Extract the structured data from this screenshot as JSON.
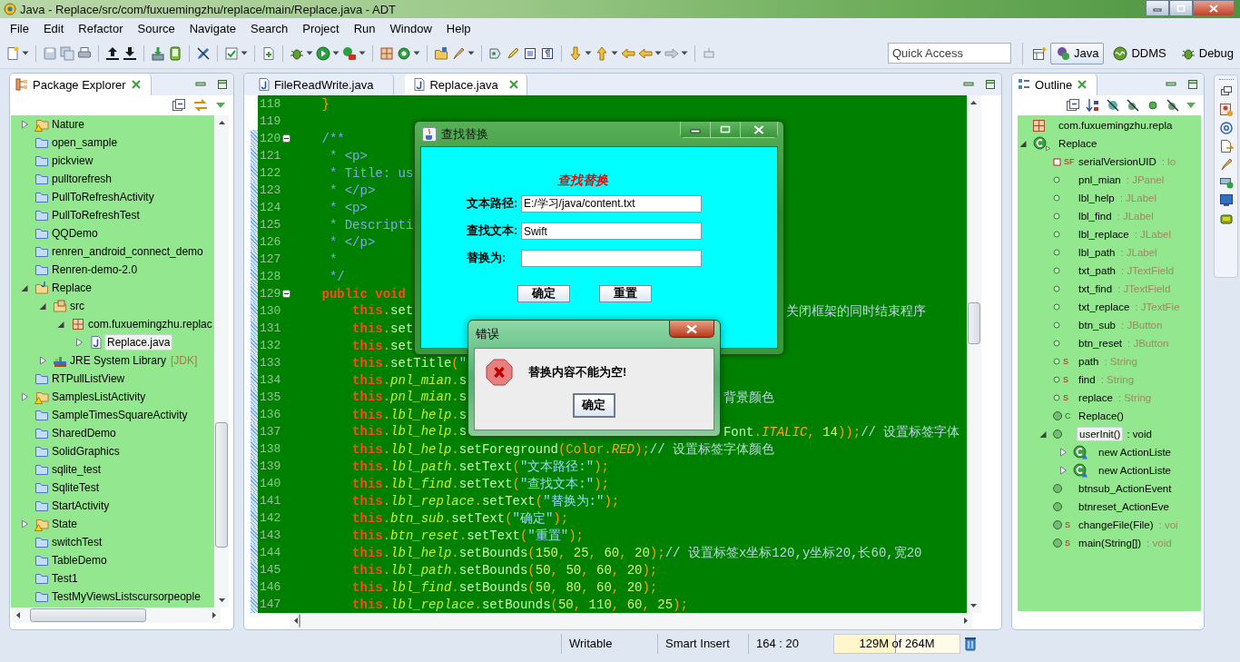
{
  "window": {
    "title": "Java - Replace/src/com/fuxuemingzhu/replace/main/Replace.java - ADT"
  },
  "menu": [
    "File",
    "Edit",
    "Refactor",
    "Source",
    "Navigate",
    "Search",
    "Project",
    "Run",
    "Window",
    "Help"
  ],
  "quick_access": {
    "placeholder": "Quick Access"
  },
  "perspectives": [
    {
      "label": "Java",
      "selected": true
    },
    {
      "label": "DDMS",
      "selected": false
    },
    {
      "label": "Debug",
      "selected": false
    }
  ],
  "package_explorer": {
    "title": "Package Explorer",
    "items": [
      {
        "name": "Nature",
        "kind": "project_warning",
        "expanded": false,
        "selected": false
      },
      {
        "name": "open_sample",
        "kind": "closed",
        "selected": false
      },
      {
        "name": "pickview",
        "kind": "closed",
        "selected": false
      },
      {
        "name": "pulltorefresh",
        "kind": "closed",
        "selected": false
      },
      {
        "name": "PullToRefreshActivity",
        "kind": "closed",
        "selected": false
      },
      {
        "name": "PullToRefreshTest",
        "kind": "closed",
        "selected": false
      },
      {
        "name": "QQDemo",
        "kind": "closed",
        "selected": false
      },
      {
        "name": "renren_android_connect_demo",
        "kind": "closed",
        "selected": false
      },
      {
        "name": "Renren-demo-2.0",
        "kind": "closed",
        "selected": false
      },
      {
        "name": "Replace",
        "kind": "java_project",
        "expanded": true,
        "selected": false,
        "children": [
          {
            "name": "src",
            "kind": "src",
            "expanded": true,
            "selected": false,
            "children": [
              {
                "name": "com.fuxuemingzhu.replac",
                "kind": "package",
                "expanded": true,
                "selected": false,
                "children": [
                  {
                    "name": "Replace.java",
                    "kind": "java",
                    "expanded": false,
                    "selected": true
                  }
                ]
              }
            ]
          },
          {
            "name": "JRE System Library",
            "decoration": "[JDK]",
            "kind": "library",
            "expanded": false,
            "selected": false
          }
        ]
      },
      {
        "name": "RTPullListView",
        "kind": "closed",
        "selected": false
      },
      {
        "name": "SamplesListActivity",
        "kind": "project_warning",
        "expanded": false,
        "selected": false
      },
      {
        "name": "SampleTimesSquareActivity",
        "kind": "closed",
        "selected": false
      },
      {
        "name": "SharedDemo",
        "kind": "closed",
        "selected": false
      },
      {
        "name": "SolidGraphics",
        "kind": "closed",
        "selected": false
      },
      {
        "name": "sqlite_test",
        "kind": "closed",
        "selected": false
      },
      {
        "name": "SqliteTest",
        "kind": "closed",
        "selected": false
      },
      {
        "name": "StartActivity",
        "kind": "closed",
        "selected": false
      },
      {
        "name": "State",
        "kind": "project_warning",
        "expanded": false,
        "selected": false
      },
      {
        "name": "switchTest",
        "kind": "closed",
        "selected": false
      },
      {
        "name": "TableDemo",
        "kind": "closed",
        "selected": false
      },
      {
        "name": "Test1",
        "kind": "closed",
        "selected": false
      },
      {
        "name": "TestMyViewsListscursorpeople",
        "kind": "closed",
        "selected": false
      }
    ]
  },
  "editor": {
    "tabs": [
      {
        "label": "FileReadWrite.java",
        "selected": false
      },
      {
        "label": "Replace.java",
        "selected": true
      }
    ],
    "lines": [
      {
        "number": "118",
        "changed": false,
        "fold": false,
        "code": [
          {
            "kind": "p",
            "text": "    }"
          }
        ]
      },
      {
        "number": "119",
        "changed": false,
        "fold": false
      },
      {
        "number": "120",
        "changed": true,
        "fold": true,
        "code": [
          {
            "kind": "doc",
            "text": "    /**"
          }
        ]
      },
      {
        "number": "121",
        "changed": true,
        "fold": false,
        "code": [
          {
            "kind": "doc",
            "text": "     * <p>"
          }
        ]
      },
      {
        "number": "122",
        "changed": true,
        "fold": false,
        "code": [
          {
            "kind": "doc",
            "text": "     * Title: us"
          }
        ]
      },
      {
        "number": "123",
        "changed": true,
        "fold": false,
        "code": [
          {
            "kind": "doc",
            "text": "     * </p>"
          }
        ]
      },
      {
        "number": "124",
        "changed": true,
        "fold": false,
        "code": [
          {
            "kind": "doc",
            "text": "     * <p>"
          }
        ]
      },
      {
        "number": "125",
        "changed": true,
        "fold": false,
        "code": [
          {
            "kind": "doc",
            "text": "     * Descripti"
          }
        ]
      },
      {
        "number": "126",
        "changed": true,
        "fold": false,
        "code": [
          {
            "kind": "doc",
            "text": "     * </p>"
          }
        ]
      },
      {
        "number": "127",
        "changed": true,
        "fold": false,
        "code": [
          {
            "kind": "doc",
            "text": "     *"
          }
        ]
      },
      {
        "number": "128",
        "changed": true,
        "fold": false,
        "code": [
          {
            "kind": "doc",
            "text": "     */"
          }
        ]
      },
      {
        "number": "129",
        "changed": true,
        "fold": true,
        "code": [
          {
            "kind": "kw",
            "text": "    public void"
          }
        ]
      },
      {
        "number": "130",
        "changed": true,
        "fold": false,
        "code": [
          {
            "kind": "kw",
            "text": "        this"
          },
          {
            "kind": "p",
            "text": "."
          },
          {
            "kind": "m",
            "text": "set"
          }
        ],
        "right": {
          "kind": "finder_window",
          "code": [
            {
              "kind": "cmt",
              "text": "关闭框架的同时结束程序"
            }
          ]
        }
      },
      {
        "number": "131",
        "changed": true,
        "fold": false,
        "code": [
          {
            "kind": "kw",
            "text": "        this"
          },
          {
            "kind": "p",
            "text": "."
          },
          {
            "kind": "m",
            "text": "set"
          }
        ]
      },
      {
        "number": "132",
        "changed": true,
        "fold": false,
        "code": [
          {
            "kind": "kw",
            "text": "        this"
          },
          {
            "kind": "p",
            "text": "."
          },
          {
            "kind": "m",
            "text": "set"
          }
        ]
      },
      {
        "number": "133",
        "changed": true,
        "fold": false,
        "code": [
          {
            "kind": "kw",
            "text": "        this"
          },
          {
            "kind": "p",
            "text": "."
          },
          {
            "kind": "m",
            "text": "setTitle"
          },
          {
            "kind": "p",
            "text": "("
          },
          {
            "kind": "str",
            "text": "\""
          }
        ]
      },
      {
        "number": "134",
        "changed": true,
        "fold": false,
        "code": [
          {
            "kind": "kw",
            "text": "        this"
          },
          {
            "kind": "p",
            "text": "."
          },
          {
            "kind": "f",
            "text": "pnl_mian"
          },
          {
            "kind": "p",
            "text": "."
          },
          {
            "kind": "m",
            "text": "s"
          }
        ]
      },
      {
        "number": "135",
        "changed": true,
        "fold": false,
        "code": [
          {
            "kind": "kw",
            "text": "        this"
          },
          {
            "kind": "p",
            "text": "."
          },
          {
            "kind": "f",
            "text": "pnl_mian"
          },
          {
            "kind": "p",
            "text": "."
          },
          {
            "kind": "m",
            "text": "s"
          }
        ],
        "right": {
          "kind": "error_dialog",
          "code": [
            {
              "kind": "cmt",
              "text": "背景颜色"
            }
          ]
        }
      },
      {
        "number": "136",
        "changed": true,
        "fold": false,
        "code": [
          {
            "kind": "kw",
            "text": "        this"
          },
          {
            "kind": "p",
            "text": "."
          },
          {
            "kind": "f",
            "text": "lbl_help"
          },
          {
            "kind": "p",
            "text": "."
          },
          {
            "kind": "m",
            "text": "s"
          }
        ]
      },
      {
        "number": "137",
        "changed": true,
        "fold": false,
        "code": [
          {
            "kind": "kw",
            "text": "        this"
          },
          {
            "kind": "p",
            "text": "."
          },
          {
            "kind": "f",
            "text": "lbl_help"
          },
          {
            "kind": "p",
            "text": "."
          },
          {
            "kind": "m",
            "text": "s"
          }
        ],
        "right": {
          "kind": "error_dialog",
          "code": [
            {
              "kind": "m",
              "text": "Font"
            },
            {
              "kind": "p",
              "text": "."
            },
            {
              "kind": "c",
              "text": "ITALIC"
            },
            {
              "kind": "p",
              "text": ", "
            },
            {
              "kind": "num",
              "text": "14"
            },
            {
              "kind": "p",
              "text": "));"
            },
            {
              "kind": "cmt",
              "text": "// 设置标签字体"
            }
          ]
        }
      },
      {
        "number": "138",
        "changed": true,
        "fold": false,
        "code": [
          {
            "kind": "kw",
            "text": "        this"
          },
          {
            "kind": "p",
            "text": "."
          },
          {
            "kind": "f",
            "text": "lbl_help"
          },
          {
            "kind": "p",
            "text": "."
          },
          {
            "kind": "m",
            "text": "setForeground"
          },
          {
            "kind": "p",
            "text": "(Color."
          },
          {
            "kind": "c",
            "text": "RED"
          },
          {
            "kind": "p",
            "text": ");"
          },
          {
            "kind": "cmt",
            "text": "// 设置标签字体颜色"
          }
        ]
      },
      {
        "number": "139",
        "changed": true,
        "fold": false,
        "code": [
          {
            "kind": "kw",
            "text": "        this"
          },
          {
            "kind": "p",
            "text": "."
          },
          {
            "kind": "f",
            "text": "lbl_path"
          },
          {
            "kind": "p",
            "text": "."
          },
          {
            "kind": "m",
            "text": "setText"
          },
          {
            "kind": "p",
            "text": "("
          },
          {
            "kind": "str",
            "text": "\"文本路径:\""
          },
          {
            "kind": "p",
            "text": ");"
          }
        ]
      },
      {
        "number": "140",
        "changed": true,
        "fold": false,
        "code": [
          {
            "kind": "kw",
            "text": "        this"
          },
          {
            "kind": "p",
            "text": "."
          },
          {
            "kind": "f",
            "text": "lbl_find"
          },
          {
            "kind": "p",
            "text": "."
          },
          {
            "kind": "m",
            "text": "setText"
          },
          {
            "kind": "p",
            "text": "("
          },
          {
            "kind": "str",
            "text": "\"查找文本:\""
          },
          {
            "kind": "p",
            "text": ");"
          }
        ]
      },
      {
        "number": "141",
        "changed": true,
        "fold": false,
        "code": [
          {
            "kind": "kw",
            "text": "        this"
          },
          {
            "kind": "p",
            "text": "."
          },
          {
            "kind": "f",
            "text": "lbl_replace"
          },
          {
            "kind": "p",
            "text": "."
          },
          {
            "kind": "m",
            "text": "setText"
          },
          {
            "kind": "p",
            "text": "("
          },
          {
            "kind": "str",
            "text": "\"替换为:\""
          },
          {
            "kind": "p",
            "text": ");"
          }
        ]
      },
      {
        "number": "142",
        "changed": true,
        "fold": false,
        "code": [
          {
            "kind": "kw",
            "text": "        this"
          },
          {
            "kind": "p",
            "text": "."
          },
          {
            "kind": "f",
            "text": "btn_sub"
          },
          {
            "kind": "p",
            "text": "."
          },
          {
            "kind": "m",
            "text": "setText"
          },
          {
            "kind": "p",
            "text": "("
          },
          {
            "kind": "str",
            "text": "\"确定\""
          },
          {
            "kind": "p",
            "text": ");"
          }
        ]
      },
      {
        "number": "143",
        "changed": true,
        "fold": false,
        "code": [
          {
            "kind": "kw",
            "text": "        this"
          },
          {
            "kind": "p",
            "text": "."
          },
          {
            "kind": "f",
            "text": "btn_reset"
          },
          {
            "kind": "p",
            "text": "."
          },
          {
            "kind": "m",
            "text": "setText"
          },
          {
            "kind": "p",
            "text": "("
          },
          {
            "kind": "str",
            "text": "\"重置\""
          },
          {
            "kind": "p",
            "text": ");"
          }
        ]
      },
      {
        "number": "144",
        "changed": true,
        "fold": false,
        "code": [
          {
            "kind": "kw",
            "text": "        this"
          },
          {
            "kind": "p",
            "text": "."
          },
          {
            "kind": "f",
            "text": "lbl_help"
          },
          {
            "kind": "p",
            "text": "."
          },
          {
            "kind": "m",
            "text": "setBounds"
          },
          {
            "kind": "p",
            "text": "("
          },
          {
            "kind": "num",
            "text": "150"
          },
          {
            "kind": "p",
            "text": ", "
          },
          {
            "kind": "num",
            "text": "25"
          },
          {
            "kind": "p",
            "text": ", "
          },
          {
            "kind": "num",
            "text": "60"
          },
          {
            "kind": "p",
            "text": ", "
          },
          {
            "kind": "num",
            "text": "20"
          },
          {
            "kind": "p",
            "text": ");"
          },
          {
            "kind": "cmt",
            "text": "// 设置标签x坐标120,y坐标20,长60,宽20"
          }
        ]
      },
      {
        "number": "145",
        "changed": true,
        "fold": false,
        "code": [
          {
            "kind": "kw",
            "text": "        this"
          },
          {
            "kind": "p",
            "text": "."
          },
          {
            "kind": "f",
            "text": "lbl_path"
          },
          {
            "kind": "p",
            "text": "."
          },
          {
            "kind": "m",
            "text": "setBounds"
          },
          {
            "kind": "p",
            "text": "("
          },
          {
            "kind": "num",
            "text": "50"
          },
          {
            "kind": "p",
            "text": ", "
          },
          {
            "kind": "num",
            "text": "50"
          },
          {
            "kind": "p",
            "text": ", "
          },
          {
            "kind": "num",
            "text": "60"
          },
          {
            "kind": "p",
            "text": ", "
          },
          {
            "kind": "num",
            "text": "20"
          },
          {
            "kind": "p",
            "text": ");"
          }
        ]
      },
      {
        "number": "146",
        "changed": true,
        "fold": false,
        "code": [
          {
            "kind": "kw",
            "text": "        this"
          },
          {
            "kind": "p",
            "text": "."
          },
          {
            "kind": "f",
            "text": "lbl_find"
          },
          {
            "kind": "p",
            "text": "."
          },
          {
            "kind": "m",
            "text": "setBounds"
          },
          {
            "kind": "p",
            "text": "("
          },
          {
            "kind": "num",
            "text": "50"
          },
          {
            "kind": "p",
            "text": ", "
          },
          {
            "kind": "num",
            "text": "80"
          },
          {
            "kind": "p",
            "text": ", "
          },
          {
            "kind": "num",
            "text": "60"
          },
          {
            "kind": "p",
            "text": ", "
          },
          {
            "kind": "num",
            "text": "20"
          },
          {
            "kind": "p",
            "text": ");"
          }
        ]
      },
      {
        "number": "147",
        "changed": true,
        "fold": false,
        "code": [
          {
            "kind": "kw",
            "text": "        this"
          },
          {
            "kind": "p",
            "text": "."
          },
          {
            "kind": "f",
            "text": "lbl_replace"
          },
          {
            "kind": "p",
            "text": "."
          },
          {
            "kind": "m",
            "text": "setBounds"
          },
          {
            "kind": "p",
            "text": "("
          },
          {
            "kind": "num",
            "text": "50"
          },
          {
            "kind": "p",
            "text": ", "
          },
          {
            "kind": "num",
            "text": "110"
          },
          {
            "kind": "p",
            "text": ", "
          },
          {
            "kind": "num",
            "text": "60"
          },
          {
            "kind": "p",
            "text": ", "
          },
          {
            "kind": "num",
            "text": "25"
          },
          {
            "kind": "p",
            "text": ");"
          }
        ]
      }
    ]
  },
  "finder_window": {
    "title": "查找替换",
    "heading": "查找替换",
    "fields": [
      {
        "label": "文本路径:",
        "value": "E:/学习/java/content.txt"
      },
      {
        "label": "查找文本:",
        "value": "Swift"
      },
      {
        "label": "替换为:"
      }
    ],
    "buttons": [
      "确定",
      "重置"
    ]
  },
  "error_dialog": {
    "title": "错误",
    "message": "替换内容不能为空!",
    "button": "确定"
  },
  "outline": {
    "title": "Outline",
    "items": [
      {
        "name": "com.fuxuemingzhu.repla",
        "kind": "package",
        "selected": false
      },
      {
        "name": "Replace",
        "kind": "class",
        "expanded": true,
        "selected": false,
        "children": [
          {
            "name": "serialVersionUID",
            "type": ": lo",
            "kind": "private_field",
            "badge": "SF",
            "selected": false
          },
          {
            "name": "pnl_mian",
            "type": ": JPanel",
            "kind": "field",
            "selected": false
          },
          {
            "name": "lbl_help",
            "type": ": JLabel",
            "kind": "field",
            "selected": false
          },
          {
            "name": "lbl_find",
            "type": ": JLabel",
            "kind": "field",
            "selected": false
          },
          {
            "name": "lbl_replace",
            "type": ": JLabel",
            "kind": "field",
            "selected": false
          },
          {
            "name": "lbl_path",
            "type": ": JLabel",
            "kind": "field",
            "selected": false
          },
          {
            "name": "txt_path",
            "type": ": JTextField",
            "kind": "field",
            "selected": false
          },
          {
            "name": "txt_find",
            "type": ": JTextField",
            "kind": "field",
            "selected": false
          },
          {
            "name": "txt_replace",
            "type": ": JTextFie",
            "kind": "field",
            "selected": false
          },
          {
            "name": "btn_sub",
            "type": ": JButton",
            "kind": "field",
            "selected": false
          },
          {
            "name": "btn_reset",
            "type": ": JButton",
            "kind": "field",
            "selected": false
          },
          {
            "name": "path",
            "type": ": String",
            "kind": "field",
            "badge": "S",
            "selected": false
          },
          {
            "name": "find",
            "type": ": String",
            "kind": "field",
            "badge": "S",
            "selected": false
          },
          {
            "name": "replace",
            "type": ": String",
            "kind": "field",
            "badge": "S",
            "selected": false
          },
          {
            "name": "Replace()",
            "kind": "method",
            "badge": "C",
            "selected": false
          },
          {
            "name": "userInit()",
            "type": ": void",
            "kind": "method",
            "expanded": true,
            "selected": true,
            "children": [
              {
                "name": "new ActionListe",
                "kind": "anonymous",
                "expanded": false,
                "selected": false
              },
              {
                "name": "new ActionListe",
                "kind": "anonymous",
                "expanded": false,
                "selected": false
              }
            ]
          },
          {
            "name": "btnsub_ActionEvent",
            "kind": "method",
            "selected": false
          },
          {
            "name": "btnreset_ActionEve",
            "kind": "method",
            "selected": false
          },
          {
            "name": "changeFile(File)",
            "type": ": voi",
            "kind": "method",
            "badge": "S",
            "selected": false
          },
          {
            "name": "main(String[])",
            "type": ": void",
            "kind": "method",
            "badge": "S",
            "selected": false
          }
        ]
      }
    ]
  },
  "status_bar": {
    "mode": "Writable",
    "insert": "Smart Insert",
    "position": "164 : 20",
    "memory": {
      "text": "129M of 264M",
      "level": 0.49
    }
  }
}
